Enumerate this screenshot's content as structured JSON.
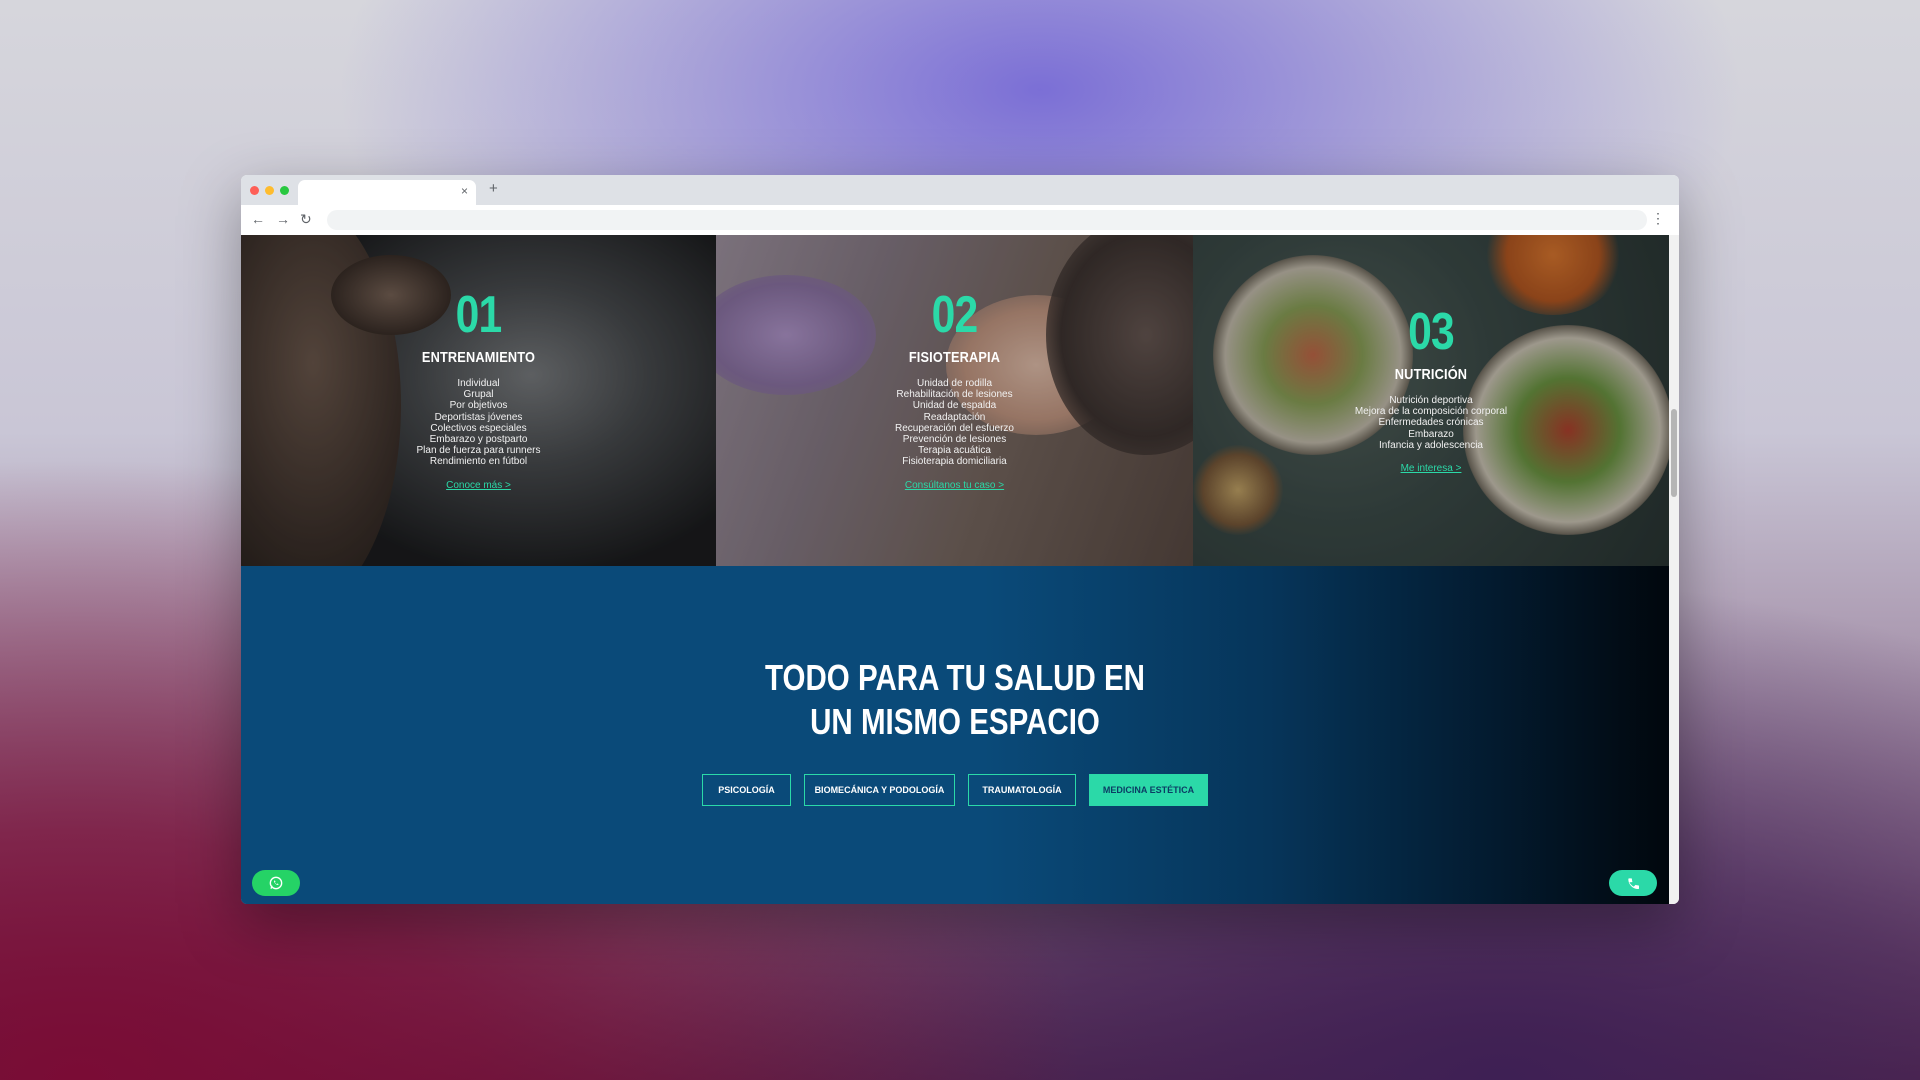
{
  "browser": {
    "tab_close_icon": "×",
    "new_tab_icon": "+",
    "back_icon": "←",
    "forward_icon": "→",
    "reload_icon": "↻",
    "menu_icon": "⋮"
  },
  "services": [
    {
      "number": "01",
      "title": "ENTRENAMIENTO",
      "items": [
        "Individual",
        "Grupal",
        "Por objetivos",
        "Deportistas jóvenes",
        "Colectivos especiales",
        "Embarazo y postparto",
        "Plan de fuerza para runners",
        "Rendimiento en fútbol"
      ],
      "link": "Conoce más >"
    },
    {
      "number": "02",
      "title": "FISIOTERAPIA",
      "items": [
        "Unidad de rodilla",
        "Rehabilitación de lesiones",
        "Unidad de espalda",
        "Readaptación",
        "Recuperación del esfuerzo",
        "Prevención de lesiones",
        "Terapia acuática",
        "Fisioterapia domiciliaria"
      ],
      "link": "Consúltanos tu caso >"
    },
    {
      "number": "03",
      "title": "NUTRICIÓN",
      "items": [
        "Nutrición deportiva",
        "Mejora de la composición corporal",
        "Enfermedades crónicas",
        "Embarazo",
        "Infancia y adolescencia"
      ],
      "link": "Me interesa >"
    }
  ],
  "cta": {
    "title_line1": "TODO PARA TU SALUD EN",
    "title_line2": "UN MISMO ESPACIO",
    "buttons": [
      {
        "label": "PSICOLOGÍA",
        "active": false
      },
      {
        "label": "BIOMECÁNICA Y PODOLOGÍA",
        "active": false
      },
      {
        "label": "TRAUMATOLOGÍA",
        "active": false
      },
      {
        "label": "MEDICINA ESTÉTICA",
        "active": true
      }
    ]
  },
  "colors": {
    "accent": "#2bd9a8",
    "cta_background": "#0a4a79",
    "whatsapp": "#25d366"
  },
  "icons": {
    "whatsapp": "whatsapp-icon",
    "phone": "phone-icon"
  }
}
